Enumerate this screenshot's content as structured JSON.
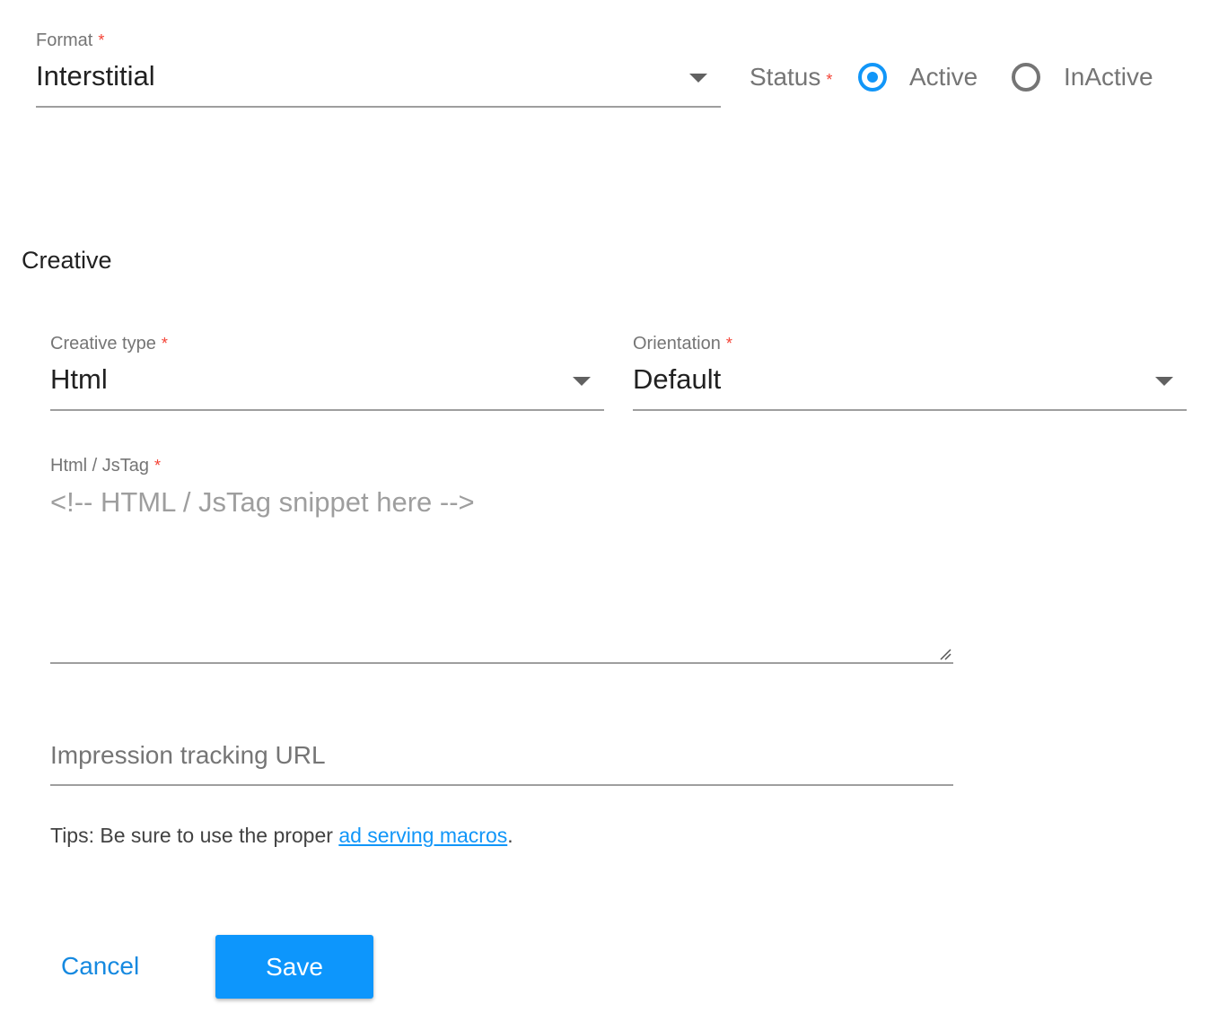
{
  "format": {
    "label": "Format",
    "required_mark": "*",
    "value": "Interstitial"
  },
  "status": {
    "label": "Status",
    "required_mark": "*",
    "options": [
      {
        "label": "Active",
        "selected": true
      },
      {
        "label": "InActive",
        "selected": false
      }
    ]
  },
  "creative_section": {
    "title": "Creative"
  },
  "creative_type": {
    "label": "Creative type",
    "required_mark": "*",
    "value": "Html"
  },
  "orientation": {
    "label": "Orientation",
    "required_mark": "*",
    "value": "Default"
  },
  "html_tag": {
    "label": "Html / JsTag",
    "required_mark": "*",
    "placeholder": "<!-- HTML / JsTag snippet here -->"
  },
  "impression_url": {
    "placeholder": "Impression tracking URL"
  },
  "tips": {
    "prefix": "Tips: Be sure to use the proper ",
    "link": "ad serving macros",
    "suffix": "."
  },
  "actions": {
    "cancel": "Cancel",
    "save": "Save"
  },
  "colors": {
    "accent": "#1196f8",
    "required": "#f44336"
  }
}
